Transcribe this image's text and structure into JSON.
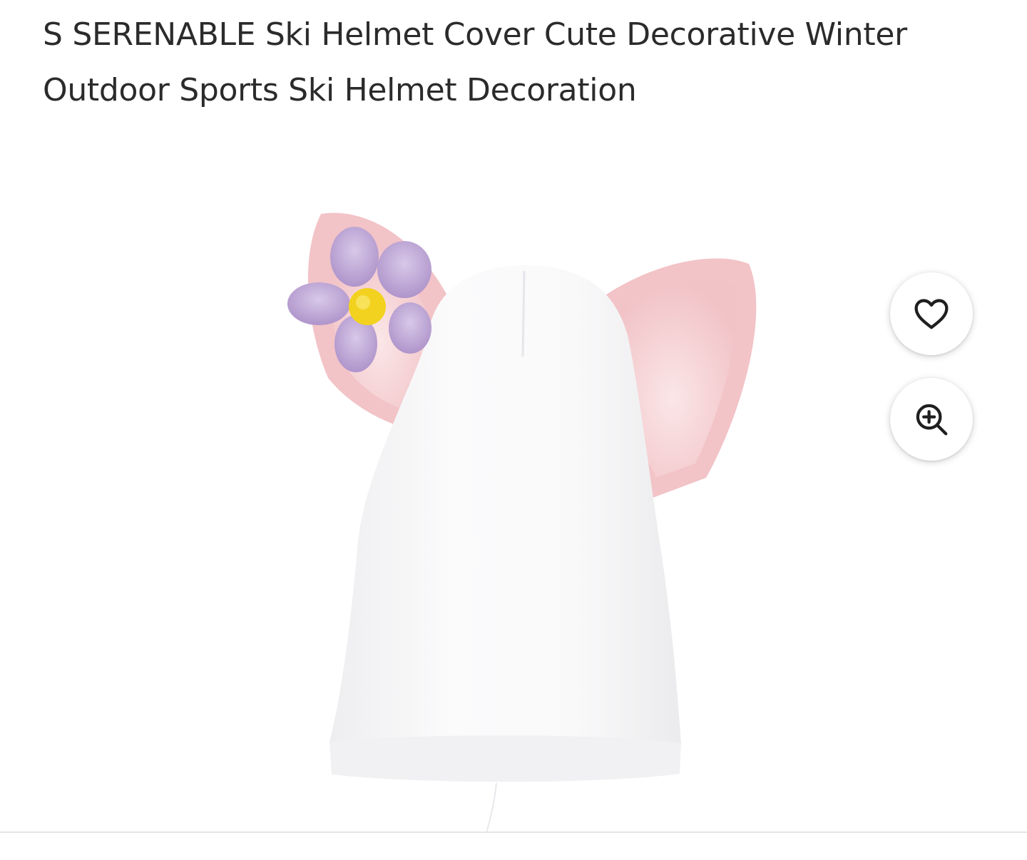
{
  "product": {
    "title": "S SERENABLE Ski Helmet Cover Cute Decorative Winter Outdoor Sports Ski Helmet Decoration"
  },
  "actions": {
    "favorite_icon": "heart-outline-icon",
    "zoom_icon": "zoom-in-icon"
  },
  "colors": {
    "hat": "#f7f7f8",
    "ear_pink": "#f3c9cc",
    "flower_petal": "#b9a2d2",
    "flower_center": "#f2d21e"
  }
}
